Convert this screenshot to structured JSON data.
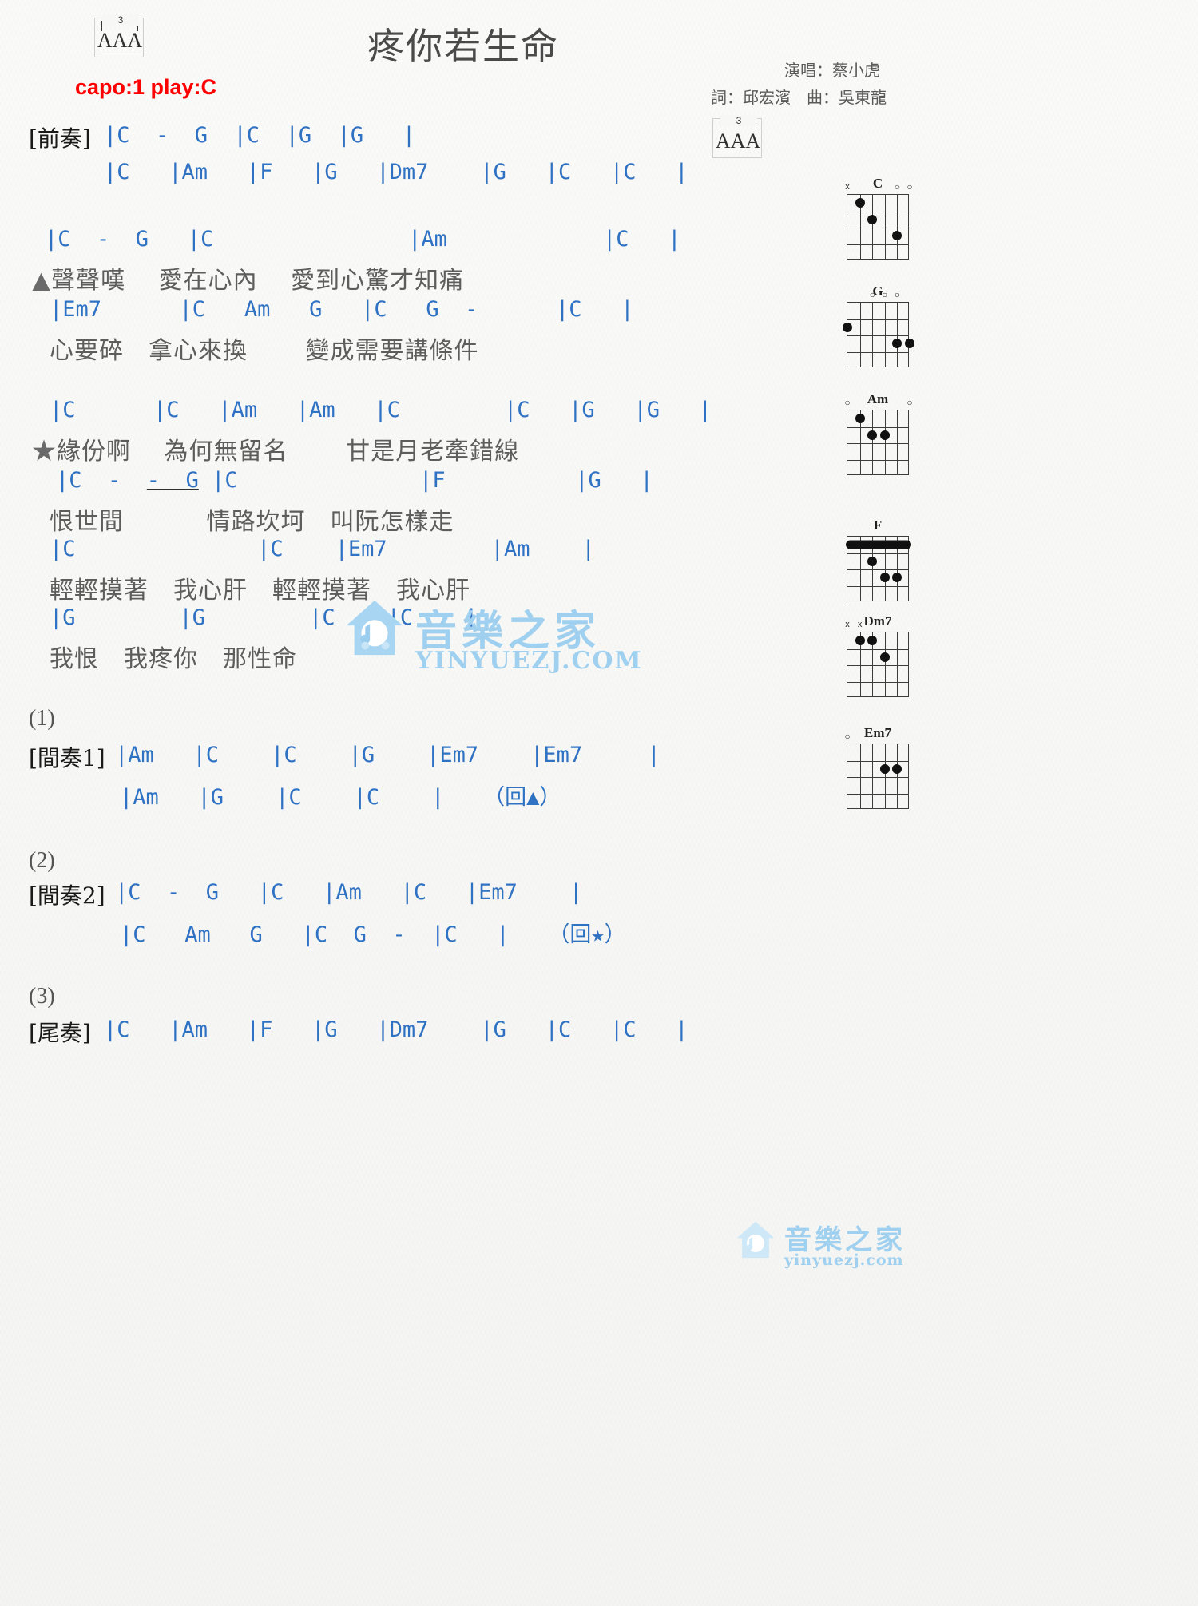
{
  "header": {
    "title": "疼你若生命",
    "capo_text": "capo:1 play:C",
    "triplet_number": "3",
    "triplet_letters": "AAA",
    "singer_credit": "演唱：蔡小虎",
    "writer_credit": "詞：邱宏濱　曲：吳東龍"
  },
  "sections": {
    "prelude_label": "[前奏]",
    "prelude_line1": "|C  -  G  |C  |G  |G   |",
    "prelude_line2": "|C   |Am   |F   |G   |Dm7    |G   |C   |C   |",
    "verse_chord1": "|C  -  G   |C               |Am            |C   |",
    "verse_lyric1_mark": "▲",
    "verse_lyric1": "聲聲嘆　 愛在心內　 愛到心驚才知痛",
    "verse_chord2": "|Em7      |C   Am   G   |C   G  -      |C   |",
    "verse_lyric2": "心要碎　拿心來換　　 變成需要講條件",
    "chorus_chord1": "|C      |C   |Am   |Am   |C        |C   |G   |G   |",
    "chorus_lyric1_mark": "★",
    "chorus_lyric1": "緣份啊　 為何無留名　　 甘是月老牽錯線",
    "chorus_chord2_a": "|C  -  ",
    "chorus_chord2_underline": "-  G",
    "chorus_chord2_b": " |C              |F          |G   |",
    "chorus_lyric2": "恨世間　　　 情路坎坷　叫阮怎樣走",
    "chorus_chord3": "|C              |C    |Em7        |Am    |",
    "chorus_lyric3": "輕輕摸著　我心肝　輕輕摸著　我心肝",
    "chorus_chord4": "|G        |G        |C    |C    |",
    "chorus_lyric4": "我恨　我疼你　那性命",
    "num1": "(1)",
    "interlude1_label": "[間奏1]",
    "interlude1_line1": "|Am   |C    |C    |G    |Em7    |Em7     |",
    "interlude1_line2": "|Am   |G    |C    |C    |   （回▲）",
    "num2": "(2)",
    "interlude2_label": "[間奏2]",
    "interlude2_line1": "|C  -  G   |C   |Am   |C   |Em7    |",
    "interlude2_line2": "|C   Am   G   |C  G  -  |C   |   （回★）",
    "num3": "(3)",
    "outro_label": "[尾奏]",
    "outro_line1": "|C   |Am   |F   |G   |Dm7    |G   |C   |C   |"
  },
  "chord_diagrams": [
    {
      "name": "C",
      "top_marks": [
        "x",
        "",
        "",
        "",
        "o",
        "o"
      ],
      "dots": [
        {
          "string": 2,
          "fret": 1
        },
        {
          "string": 3,
          "fret": 2
        },
        {
          "string": 5,
          "fret": 3
        }
      ]
    },
    {
      "name": "G",
      "top_marks": [
        "",
        "",
        "o",
        "o",
        "o",
        ""
      ],
      "dots": [
        {
          "string": 1,
          "fret": 2
        },
        {
          "string": 6,
          "fret": 3
        },
        {
          "string": 5,
          "fret": 3
        }
      ]
    },
    {
      "name": "Am",
      "top_marks": [
        "o",
        "",
        "",
        "",
        "",
        "o"
      ],
      "dots": [
        {
          "string": 2,
          "fret": 1
        },
        {
          "string": 3,
          "fret": 2
        },
        {
          "string": 4,
          "fret": 2
        }
      ]
    },
    {
      "name": "F",
      "top_marks": [
        "",
        "",
        "",
        "",
        "",
        ""
      ],
      "barre_fret": 1,
      "dots": [
        {
          "string": 3,
          "fret": 2
        },
        {
          "string": 4,
          "fret": 3
        },
        {
          "string": 5,
          "fret": 3
        }
      ]
    },
    {
      "name": "Dm7",
      "top_marks": [
        "x",
        "x",
        "",
        "",
        "",
        ""
      ],
      "dots": [
        {
          "string": 2,
          "fret": 1
        },
        {
          "string": 3,
          "fret": 1
        },
        {
          "string": 4,
          "fret": 2
        }
      ]
    },
    {
      "name": "Em7",
      "top_marks": [
        "o",
        "",
        "",
        "",
        "",
        ""
      ],
      "dots": [
        {
          "string": 4,
          "fret": 2
        },
        {
          "string": 5,
          "fret": 2
        }
      ]
    }
  ],
  "watermarks": {
    "center_cn": "音樂之家",
    "center_en": "YINYUEZJ.COM",
    "corner_cn": "音樂之家",
    "corner_en": "yinyuezj.com"
  },
  "colors": {
    "chord_blue": "#2f72c4",
    "bar_gold": "#c08a2e",
    "capo_red": "#ff0000",
    "lyric_gray": "#5d5d5d",
    "watermark_blue": "#9fd0ef"
  }
}
